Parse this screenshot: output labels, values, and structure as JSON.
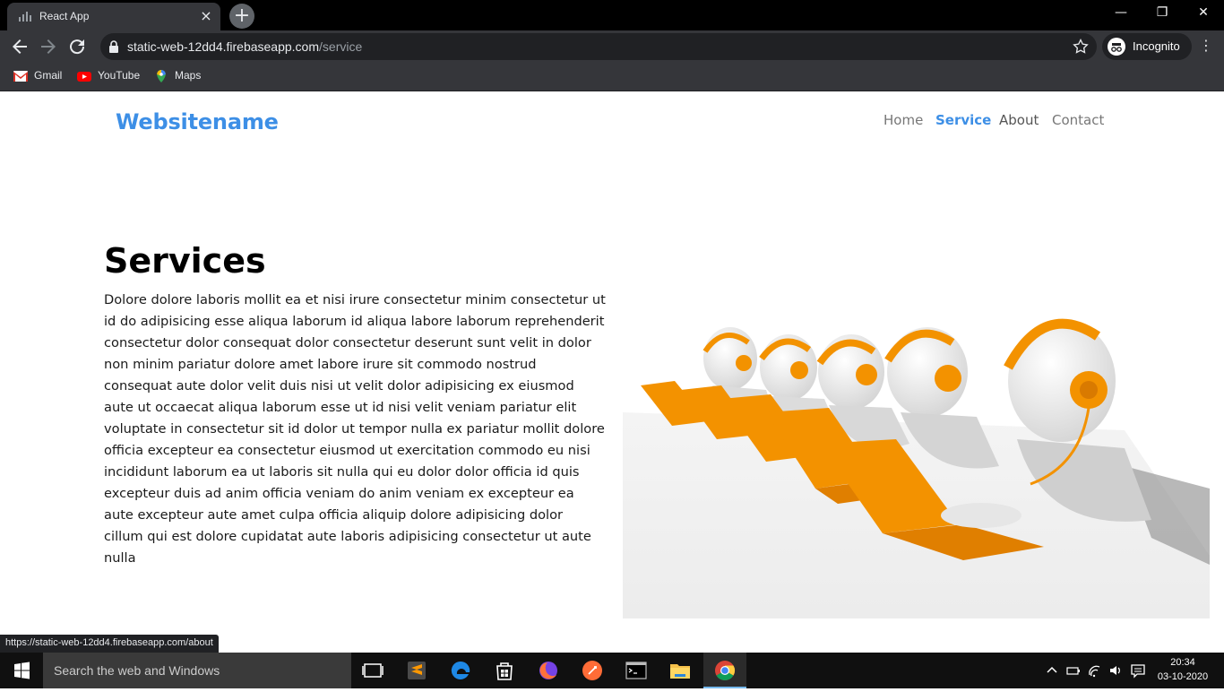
{
  "browser": {
    "tab": {
      "title": "React App",
      "close": "×"
    },
    "new_tab": "+",
    "window_controls": {
      "minimize": "—",
      "maximize": "❐",
      "close": "✕"
    },
    "url": {
      "host": "static-web-12dd4.firebaseapp.com",
      "path": "/service"
    },
    "incognito_label": "Incognito",
    "menu": "⋮",
    "bookmarks": [
      {
        "label": "Gmail",
        "icon": "gmail-icon"
      },
      {
        "label": "YouTube",
        "icon": "youtube-icon"
      },
      {
        "label": "Maps",
        "icon": "maps-icon"
      }
    ],
    "status_url": "https://static-web-12dd4.firebaseapp.com/about"
  },
  "site": {
    "brand": "Websitename",
    "nav": [
      {
        "label": "Home",
        "active": false
      },
      {
        "label": "Service",
        "active": true
      },
      {
        "label": "About",
        "active": false
      },
      {
        "label": "Contact",
        "active": false
      }
    ],
    "section": {
      "heading": "Services",
      "body": "Dolore dolore laboris mollit ea et nisi irure consectetur minim consectetur ut id do adipisicing esse aliqua laborum id aliqua labore laborum reprehenderit consectetur dolor consequat dolor consectetur deserunt sunt velit in dolor non minim pariatur dolore amet labore irure sit commodo nostrud consequat aute dolor velit duis nisi ut velit dolor adipisicing ex eiusmod aute ut occaecat aliqua laborum esse ut id nisi velit veniam pariatur elit voluptate in consectetur sit id dolor ut tempor nulla ex pariatur mollit dolore officia excepteur ea consectetur eiusmod ut exercitation commodo eu nisi incididunt laborum ea ut laboris sit nulla qui eu dolor dolor officia id quis excepteur duis ad anim officia veniam do anim veniam ex excepteur ea aute excepteur aute amet culpa officia aliquip dolore adipisicing dolor cillum qui est dolore cupidatat aute laboris adipisicing consectetur ut aute nulla"
    }
  },
  "taskbar": {
    "search_placeholder": "Search the web and Windows",
    "apps": [
      "task-view-icon",
      "sublime-text-icon",
      "edge-icon",
      "store-icon",
      "firefox-icon",
      "postman-icon",
      "terminal-icon",
      "file-explorer-icon",
      "chrome-icon"
    ],
    "clock": {
      "time": "20:34",
      "date": "03-10-2020"
    }
  },
  "colors": {
    "accent": "#3d8fe6",
    "headset": "#f39200"
  }
}
